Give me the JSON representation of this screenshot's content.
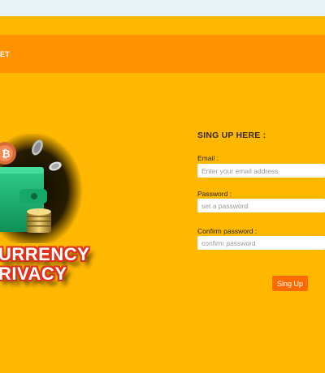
{
  "navbar": {
    "brand_fragment": "ET"
  },
  "hero": {
    "line1": "URRENCY",
    "line2": "RIVACY"
  },
  "signup": {
    "title": "SING UP HERE :",
    "email_label": "Email :",
    "email_placeholder": "Enter your email address",
    "password_label": "Password :",
    "password_placeholder": "set a password",
    "confirm_label": "Confirm password :",
    "confirm_placeholder": "confirm password",
    "submit_label": "Sing Up"
  },
  "colors": {
    "page_background": "#ffb800",
    "navbar": "#ff9200",
    "top_strip": "#e9f2f6",
    "button": "#ff6a00",
    "hero_outline": "#e0321a"
  },
  "icons": [
    "wallet-icon",
    "bitcoin-coin-icon",
    "coin-stack-icon"
  ]
}
